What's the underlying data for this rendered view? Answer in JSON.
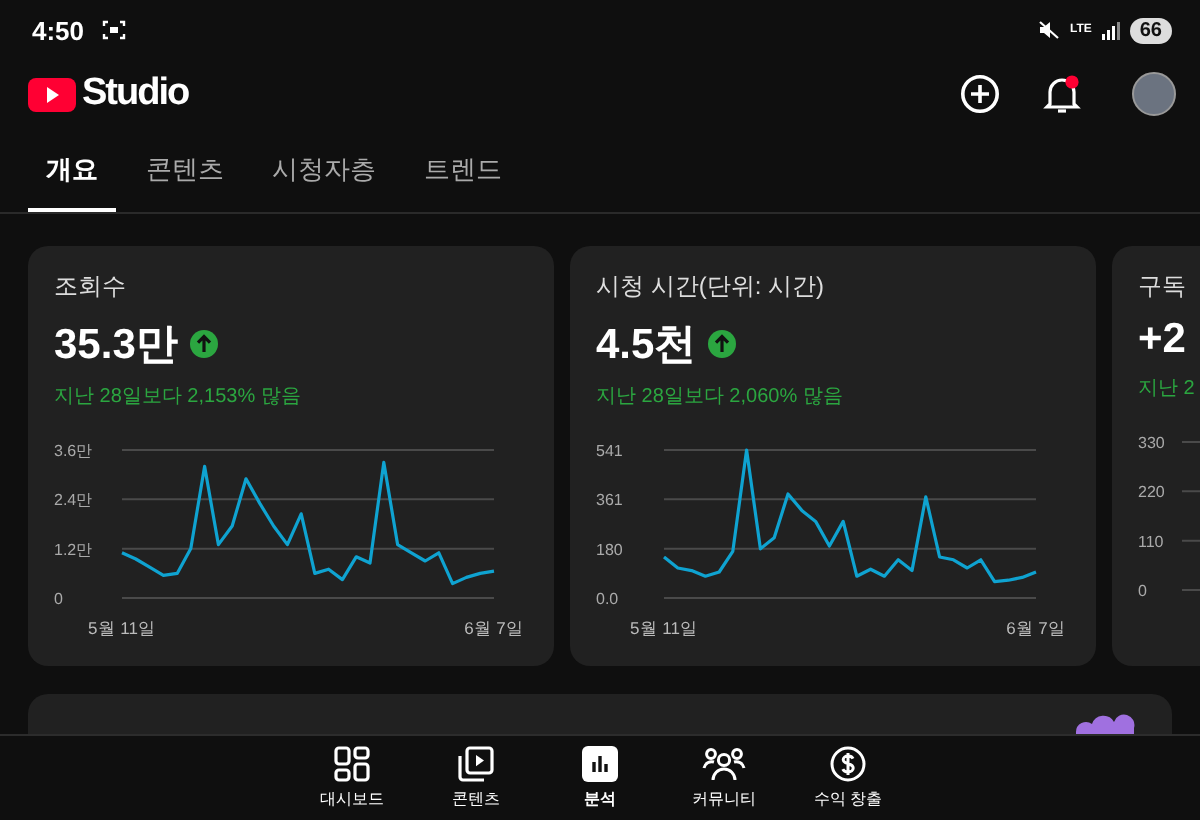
{
  "status_bar": {
    "time": "4:50",
    "network": "LTE",
    "battery": "66"
  },
  "header": {
    "logo_text": "Studio"
  },
  "tabs": [
    {
      "label": "개요",
      "selected": true
    },
    {
      "label": "콘텐츠",
      "selected": false
    },
    {
      "label": "시청자층",
      "selected": false
    },
    {
      "label": "트렌드",
      "selected": false
    }
  ],
  "cards": [
    {
      "title": "조회수",
      "value": "35.3만",
      "increase": true,
      "comparison": "지난 28일보다 2,153% 많음",
      "chart_data": {
        "type": "line",
        "categories": [
          "5월 11일",
          null,
          null,
          null,
          null,
          null,
          null,
          null,
          null,
          null,
          null,
          null,
          null,
          null,
          null,
          null,
          null,
          null,
          null,
          null,
          null,
          null,
          null,
          null,
          null,
          null,
          null,
          "6월 7일"
        ],
        "ylim": [
          0,
          3.6
        ],
        "yticks": [
          {
            "value": 0,
            "label": "0"
          },
          {
            "value": 1.2,
            "label": "1.2만"
          },
          {
            "value": 2.4,
            "label": "2.4만"
          },
          {
            "value": 3.6,
            "label": "3.6만"
          }
        ],
        "series": [
          {
            "color": "#0fa3d1",
            "values": [
              1.1,
              0.95,
              0.75,
              0.55,
              0.6,
              1.2,
              3.2,
              1.3,
              1.75,
              2.9,
              2.3,
              1.75,
              1.3,
              2.05,
              0.6,
              0.7,
              0.45,
              1.0,
              0.85,
              3.3,
              1.3,
              1.1,
              0.9,
              1.1,
              0.35,
              0.5,
              0.6,
              0.65
            ]
          }
        ]
      }
    },
    {
      "title": "시청 시간(단위: 시간)",
      "value": "4.5천",
      "increase": true,
      "comparison": "지난 28일보다 2,060% 많음",
      "chart_data": {
        "type": "line",
        "categories": [
          "5월 11일",
          null,
          null,
          null,
          null,
          null,
          null,
          null,
          null,
          null,
          null,
          null,
          null,
          null,
          null,
          null,
          null,
          null,
          null,
          null,
          null,
          null,
          null,
          null,
          null,
          null,
          null,
          "6월 7일"
        ],
        "ylim": [
          0,
          541
        ],
        "yticks": [
          {
            "value": 0,
            "label": "0.0"
          },
          {
            "value": 180,
            "label": "180"
          },
          {
            "value": 361,
            "label": "361"
          },
          {
            "value": 541,
            "label": "541"
          }
        ],
        "series": [
          {
            "color": "#0fa3d1",
            "values": [
              150,
              110,
              100,
              80,
              95,
              170,
              541,
              180,
              220,
              380,
              320,
              280,
              190,
              280,
              80,
              105,
              80,
              140,
              100,
              370,
              150,
              140,
              110,
              140,
              60,
              65,
              75,
              95
            ]
          }
        ]
      }
    },
    {
      "title": "구독",
      "value": "+2",
      "comparison": "지난 2",
      "axis_labels": [
        "330",
        "220",
        "110",
        "0"
      ]
    }
  ],
  "bottom_nav": [
    {
      "label": "대시보드",
      "selected": false
    },
    {
      "label": "콘텐츠",
      "selected": false
    },
    {
      "label": "분석",
      "selected": true
    },
    {
      "label": "커뮤니티",
      "selected": false
    },
    {
      "label": "수익 창출",
      "selected": false
    }
  ]
}
